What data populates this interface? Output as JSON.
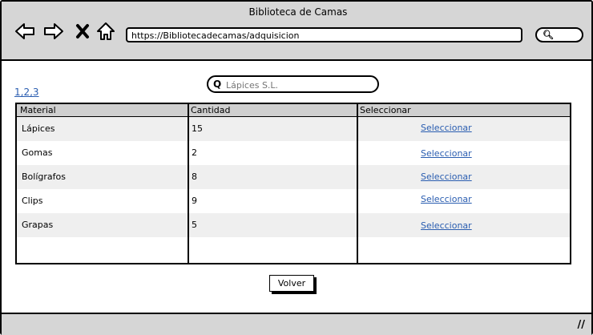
{
  "window": {
    "title": "Biblioteca de Camas"
  },
  "browser": {
    "url": "https://Bibliotecadecamas/adquisicion",
    "search_icon": "search-icon"
  },
  "page": {
    "pager": "1,2,3",
    "search": {
      "value": "",
      "placeholder": "Lápices S.L."
    },
    "table": {
      "headers": [
        "Material",
        "Cantidad",
        "Seleccionar"
      ],
      "rows": [
        {
          "material": "Lápices",
          "cantidad": "15",
          "action": "Seleccionar"
        },
        {
          "material": "Gomas",
          "cantidad": "2",
          "action": "Seleccionar"
        },
        {
          "material": "Bolígrafos",
          "cantidad": "8",
          "action": "Seleccionar"
        },
        {
          "material": "Clips",
          "cantidad": "9",
          "action": "Seleccionar"
        },
        {
          "material": "Grapas",
          "cantidad": "5",
          "action": "Seleccionar"
        }
      ]
    },
    "back_button": "Volver"
  }
}
